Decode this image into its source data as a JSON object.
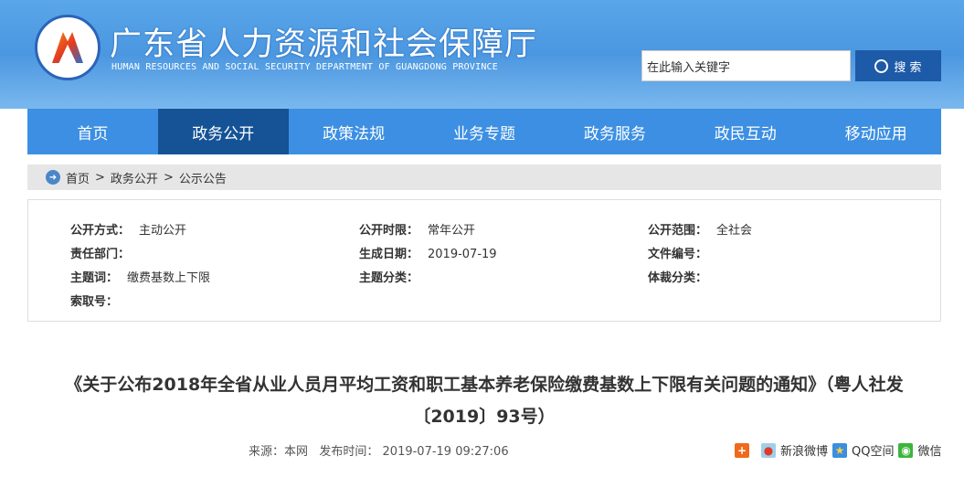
{
  "header": {
    "title": "广东省人力资源和社会保障厅",
    "subtitle": "HUMAN RESOURCES AND SOCIAL SECURITY DEPARTMENT OF GUANGDONG PROVINCE",
    "search_placeholder": "在此输入关键字",
    "search_label": "搜 索"
  },
  "nav": [
    "首页",
    "政务公开",
    "政策法规",
    "业务专题",
    "政务服务",
    "政民互动",
    "移动应用"
  ],
  "breadcrumb": [
    "首页",
    ">",
    "政务公开",
    ">",
    "公示公告"
  ],
  "meta": [
    {
      "label": "公开方式：",
      "value": "主动公开"
    },
    {
      "label": "公开时限：",
      "value": "常年公开"
    },
    {
      "label": "公开范围：",
      "value": "全社会"
    },
    {
      "label": "责任部门：",
      "value": ""
    },
    {
      "label": "生成日期：",
      "value": "2019-07-19"
    },
    {
      "label": "文件编号：",
      "value": ""
    },
    {
      "label": "主题词：",
      "value": "缴费基数上下限"
    },
    {
      "label": "主题分类：",
      "value": ""
    },
    {
      "label": "体裁分类：",
      "value": ""
    },
    {
      "label": "索取号：",
      "value": ""
    }
  ],
  "article": {
    "title": "《关于公布2018年全省从业人员月平均工资和职工基本养老保险缴费基数上下限有关问题的通知》（粤人社发〔2019〕93号）",
    "source": "来源：本网   发布时间： 2019-07-19 09:27:06"
  },
  "share": {
    "weibo": "新浪微博",
    "qzone": "QQ空间",
    "wechat": "微信"
  }
}
